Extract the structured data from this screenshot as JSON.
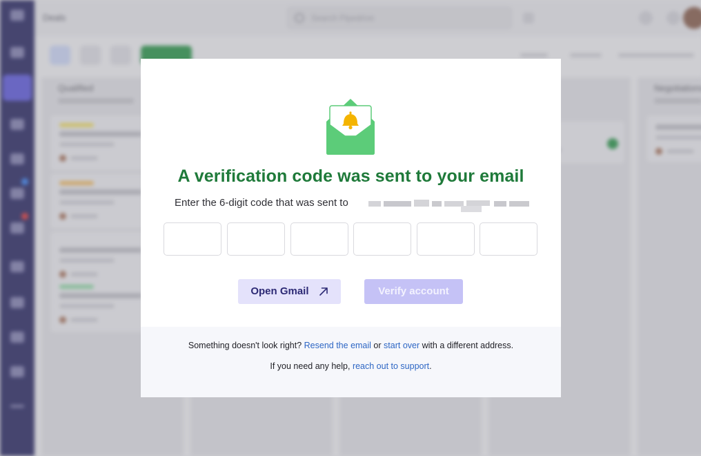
{
  "background": {
    "page_title": "Deals",
    "search": {
      "placeholder": "Search Pipedrive"
    },
    "columns": [
      {
        "title": "Qualified"
      },
      {
        "title": ""
      },
      {
        "title": ""
      },
      {
        "title": ""
      },
      {
        "title": "Negotiations"
      }
    ]
  },
  "modal": {
    "icon": "envelope-bell-icon",
    "heading": "A verification code was sent to your email",
    "subtext": "Enter the 6-digit code that was sent to",
    "code_digits": [
      "",
      "",
      "",
      "",
      "",
      ""
    ],
    "buttons": {
      "open_gmail": "Open Gmail",
      "open_gmail_icon": "external-arrow-icon",
      "verify": "Verify account"
    },
    "footer": {
      "line1_before": "Something doesn't look right?",
      "resend_link": "Resend the email",
      "or_text": "or",
      "start_over_link": "start over",
      "line1_after": "with a different address.",
      "line2_before": "If you need any help,",
      "support_link": "reach out to support",
      "line2_after": "."
    }
  },
  "colors": {
    "heading_green": "#1f7a3a",
    "envelope_green": "#5ccc79",
    "bell_yellow": "#f4b400",
    "link_blue": "#2d66c4",
    "primary_button_disabled": "#c5c2f6",
    "secondary_button": "#e4e2fb"
  }
}
